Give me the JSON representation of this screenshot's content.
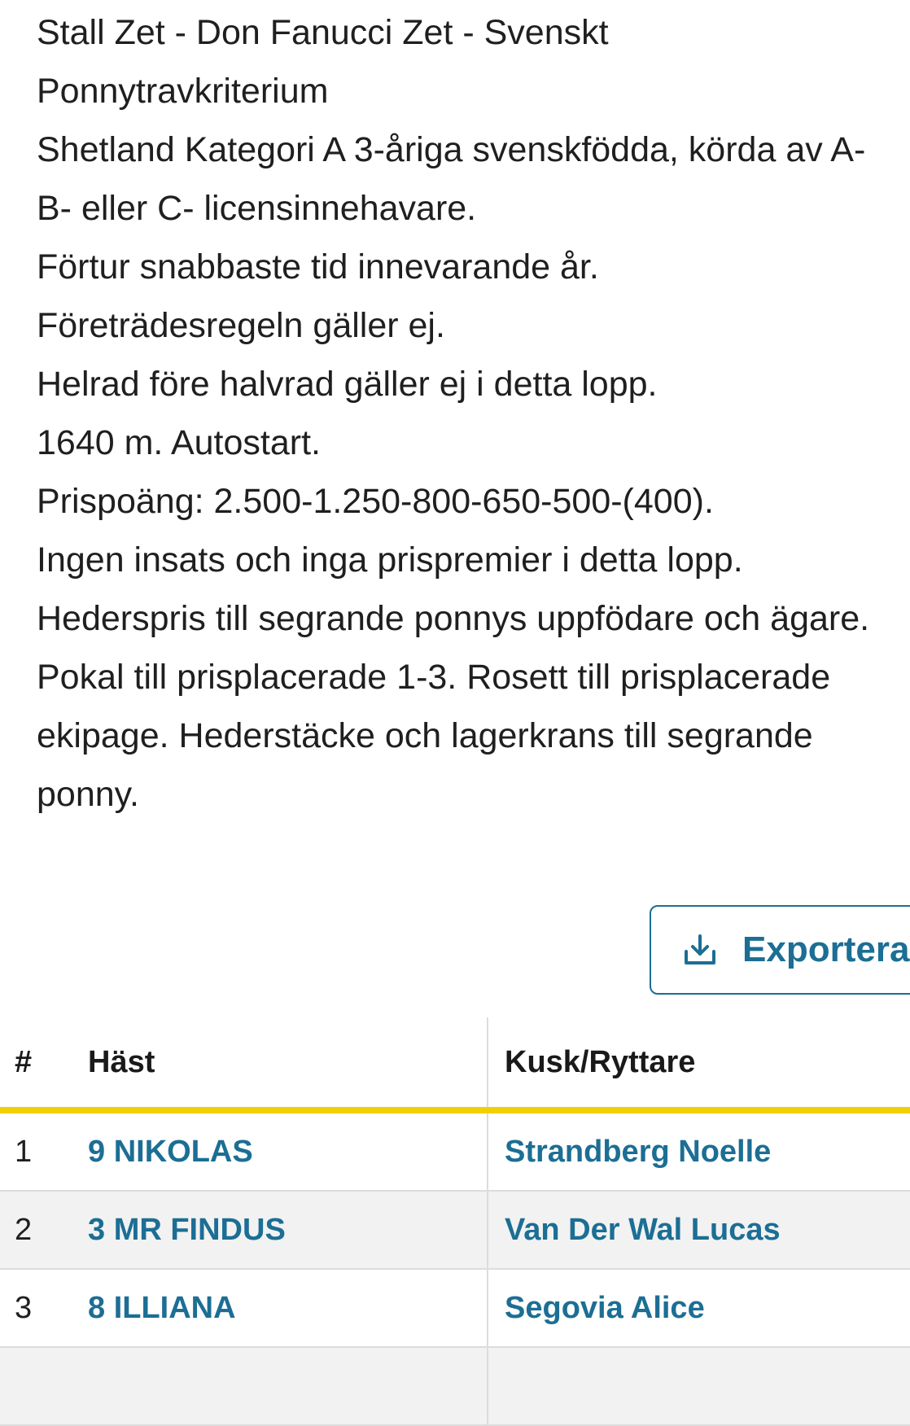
{
  "race": {
    "description_lines": [
      "Stall Zet - Don Fanucci Zet - Svenskt Ponnytravkriterium",
      "Shetland Kategori A 3-åriga svenskfödda, körda av A-B- eller C- licensinnehavare.",
      "Förtur snabbaste tid innevarande år.",
      "Företrädesregeln gäller ej.",
      "Helrad före halvrad gäller ej i detta lopp.",
      "1640 m. Autostart.",
      "Prispoäng: 2.500-1.250-800-650-500-(400).",
      "Ingen insats och inga prispremier i detta lopp.",
      "Hederspris till segrande ponnys uppfödare och ägare. Pokal till prisplacerade 1-3. Rosett till prisplacerade ekipage. Hederstäcke och lagerkrans till segrande ponny."
    ]
  },
  "export": {
    "label": "Exportera",
    "icon": "download-icon"
  },
  "table": {
    "headers": {
      "num": "#",
      "horse": "Häst",
      "driver": "Kusk/Ryttare"
    },
    "rows": [
      {
        "pos": "1",
        "horse": "9 NIKOLAS",
        "driver": "Strandberg Noelle"
      },
      {
        "pos": "2",
        "horse": "3 MR FINDUS",
        "driver": "Van Der Wal Lucas"
      },
      {
        "pos": "3",
        "horse": "8 ILLIANA",
        "driver": "Segovia Alice"
      },
      {
        "pos": "",
        "horse": "",
        "driver": ""
      }
    ]
  },
  "colors": {
    "link": "#1c6e94",
    "header_underline": "#f2cf00",
    "row_stripe": "#f2f2f2",
    "border": "#dcdcdc"
  }
}
